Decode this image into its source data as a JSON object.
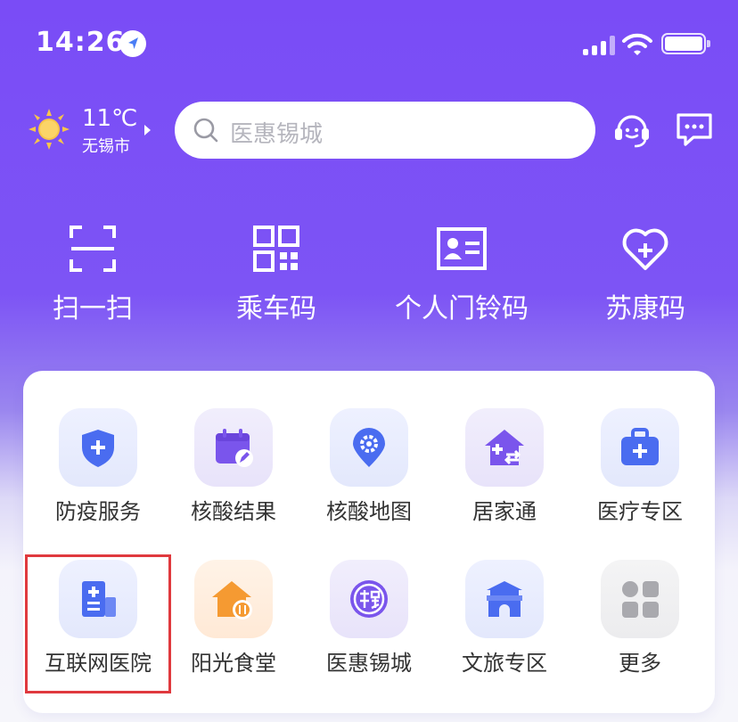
{
  "status": {
    "time": "14:26"
  },
  "weather": {
    "temp": "11℃",
    "city": "无锡市"
  },
  "search": {
    "placeholder": "医惠锡城"
  },
  "quick": [
    {
      "label": "扫一扫",
      "icon": "scan-icon"
    },
    {
      "label": "乘车码",
      "icon": "qr-code-icon"
    },
    {
      "label": "个人门铃码",
      "icon": "id-card-icon"
    },
    {
      "label": "苏康码",
      "icon": "heart-plus-icon"
    }
  ],
  "services": [
    {
      "label": "防疫服务",
      "icon": "shield-plus-icon"
    },
    {
      "label": "核酸结果",
      "icon": "calendar-pen-icon"
    },
    {
      "label": "核酸地图",
      "icon": "map-pin-gear-icon"
    },
    {
      "label": "居家通",
      "icon": "home-plus-icon"
    },
    {
      "label": "医疗专区",
      "icon": "medical-kit-icon"
    },
    {
      "label": "互联网医院",
      "icon": "hospital-building-icon"
    },
    {
      "label": "阳光食堂",
      "icon": "home-dining-icon"
    },
    {
      "label": "医惠锡城",
      "icon": "xi-seal-icon"
    },
    {
      "label": "文旅专区",
      "icon": "city-gate-icon"
    },
    {
      "label": "更多",
      "icon": "grid-more-icon"
    }
  ],
  "colors": {
    "brand": "#7a4cf6",
    "accent_blue": "#4a6cf0",
    "accent_purple": "#7a55ec",
    "accent_orange": "#f59a32",
    "highlight": "#e0393e"
  }
}
